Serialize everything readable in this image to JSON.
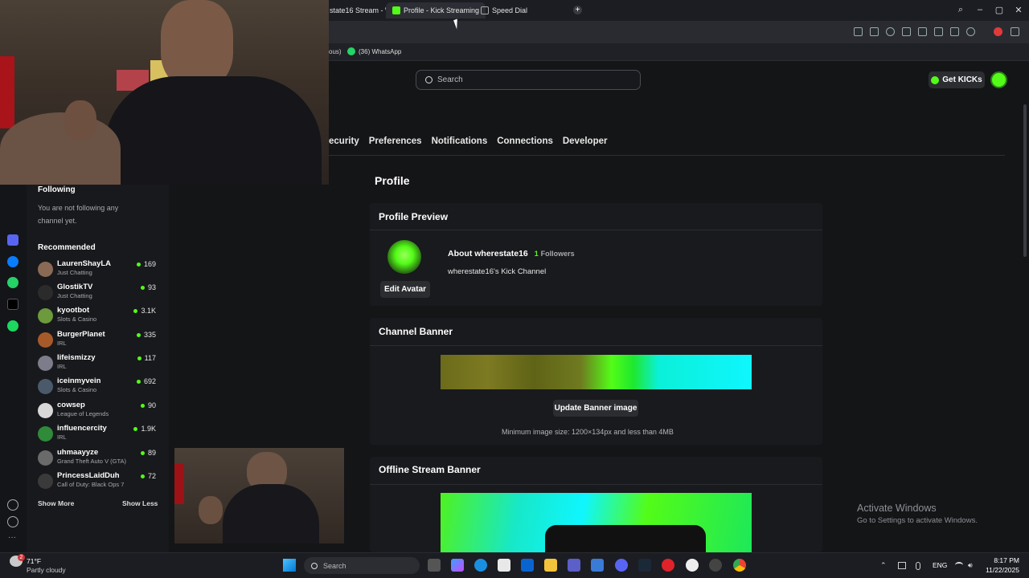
{
  "browser": {
    "tabs": [
      {
        "label": "state16 Stream - Wi",
        "active": false
      },
      {
        "label": "Profile - Kick Streaming",
        "active": true
      },
      {
        "label": "Speed Dial",
        "active": false
      }
    ],
    "bookmarks": [
      {
        "label": "ous)"
      },
      {
        "label": "(36) WhatsApp"
      }
    ]
  },
  "header": {
    "search_placeholder": "Search",
    "get_kicks_label": "Get KICKs"
  },
  "settings_tabs": [
    "ecurity",
    "Preferences",
    "Notifications",
    "Connections",
    "Developer"
  ],
  "profile": {
    "page_title": "Profile",
    "preview_title": "Profile Preview",
    "about_label": "About wherestate16",
    "followers_count": "1",
    "followers_label": "Followers",
    "channel_desc": "wherestate16's Kick Channel",
    "edit_avatar_label": "Edit Avatar",
    "banner_title": "Channel Banner",
    "update_banner_label": "Update Banner image",
    "banner_hint": "Minimum image size: 1200×134px and less than 4MB",
    "offline_title": "Offline Stream Banner"
  },
  "sidebar": {
    "following_title": "Following",
    "following_empty": "You are not following any channel yet.",
    "recommended_title": "Recommended",
    "channels": [
      {
        "name": "LaurenShayLA",
        "category": "Just Chatting",
        "viewers": "169",
        "color": "#8a6a55"
      },
      {
        "name": "GlostikTV",
        "category": "Just Chatting",
        "viewers": "93",
        "color": "#2b2b2b"
      },
      {
        "name": "kyootbot",
        "category": "Slots & Casino",
        "viewers": "3.1K",
        "color": "#6c9a3c"
      },
      {
        "name": "BurgerPlanet",
        "category": "IRL",
        "viewers": "335",
        "color": "#a65a2a"
      },
      {
        "name": "lifeismizzy",
        "category": "IRL",
        "viewers": "117",
        "color": "#7c7c8a"
      },
      {
        "name": "iceinmyvein",
        "category": "Slots & Casino",
        "viewers": "692",
        "color": "#4a5a6a"
      },
      {
        "name": "cowsep",
        "category": "League of Legends",
        "viewers": "90",
        "color": "#d8d8d8"
      },
      {
        "name": "influencercity",
        "category": "IRL",
        "viewers": "1.9K",
        "color": "#2f8a3a"
      },
      {
        "name": "uhmaayyze",
        "category": "Grand Theft Auto V (GTA)",
        "viewers": "89",
        "color": "#6a6a6a"
      },
      {
        "name": "PrincessLaidDuh",
        "category": "Call of Duty: Black Ops 7",
        "viewers": "72",
        "color": "#3a3a3a"
      }
    ],
    "show_more": "Show More",
    "show_less": "Show Less"
  },
  "watermark": {
    "title": "Activate Windows",
    "subtitle": "Go to Settings to activate Windows."
  },
  "taskbar": {
    "weather_temp": "71°F",
    "weather_desc": "Partly cloudy",
    "weather_badge": "2",
    "search_label": "Search",
    "lang": "ENG",
    "time": "8:17 PM",
    "date": "11/22/2025"
  },
  "colors": {
    "kick_green": "#53fc18",
    "background": "#141517",
    "panel": "#191a1d"
  }
}
